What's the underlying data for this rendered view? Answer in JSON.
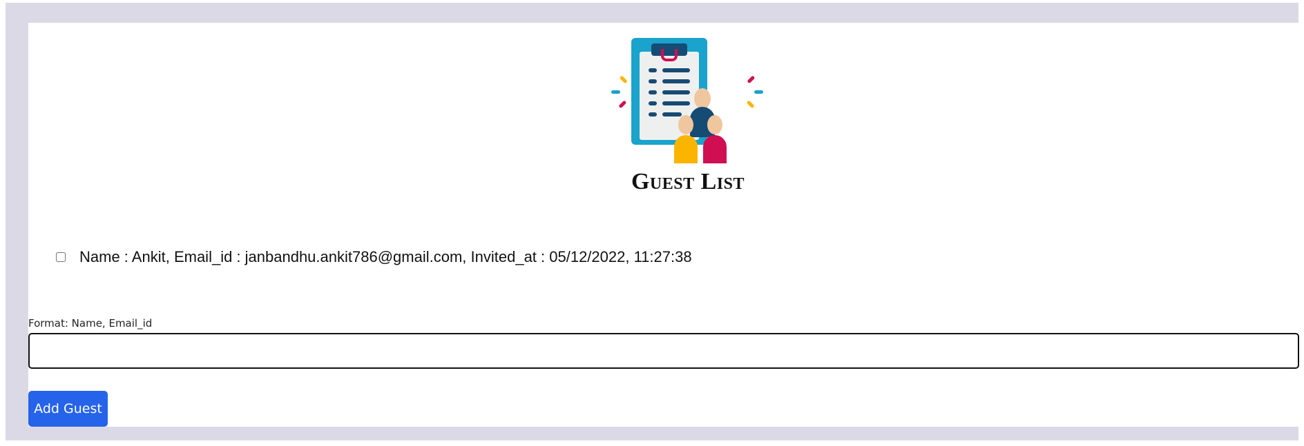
{
  "logo": {
    "title": "Guest List",
    "icon": "clipboard-guests-icon"
  },
  "guests": [
    {
      "text": "Name : Ankit, Email_id : janbandhu.ankit786@gmail.com, Invited_at : 05/12/2022, 11:27:38",
      "checked": false
    }
  ],
  "form": {
    "label": "Format: Name, Email_id",
    "input_value": "",
    "button_label": "Add Guest"
  },
  "colors": {
    "frame_background": "#dcd9e7",
    "card_background": "#ffffff",
    "button": "#2563eb",
    "clipboard_frame": "#1aa3cc",
    "clipboard_clip": "#164b74",
    "accent_pink": "#cf0f51",
    "accent_yellow": "#fbb400"
  }
}
